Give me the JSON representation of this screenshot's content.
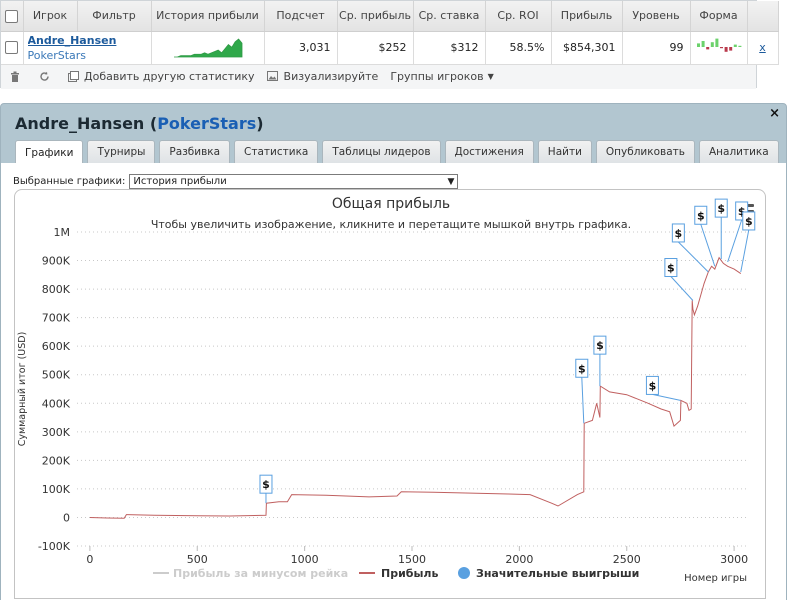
{
  "stats_table": {
    "headers": [
      "Игрок",
      "Фильтр",
      "История прибыли",
      "Подсчет",
      "Ср. прибыль",
      "Ср. ставка",
      "Ср. ROI",
      "Прибыль",
      "Уровень",
      "Форма"
    ],
    "row": {
      "player_name": "Andre_Hansen",
      "player_site": "PokerStars",
      "count": "3,031",
      "avg_profit": "$252",
      "avg_stake": "$312",
      "avg_roi": "58.5%",
      "profit": "$854,301",
      "level": "99",
      "remove_label": "x"
    },
    "history_sparkline": [
      0,
      0,
      1,
      1,
      1,
      1,
      2,
      2,
      2,
      3,
      2,
      3,
      4,
      5,
      3,
      6,
      9,
      7,
      11,
      13,
      10
    ],
    "form_bars": [
      3,
      5,
      -2,
      4,
      7,
      -1,
      -4,
      -3,
      2,
      1
    ]
  },
  "toolbar": {
    "add_stat": "Добавить другую статистику",
    "visualize": "Визуализируйте",
    "groups": "Группы игроков"
  },
  "panel": {
    "player_name": "Andre_Hansen",
    "site": "PokerStars",
    "close": "×",
    "tabs": [
      "Графики",
      "Турниры",
      "Разбивка",
      "Статистика",
      "Таблицы лидеров",
      "Достижения",
      "Найти",
      "Опубликовать",
      "Аналитика"
    ],
    "active_tab": 0
  },
  "graph_select": {
    "label": "Выбранные графики:",
    "value": "История прибыли"
  },
  "colors": {
    "profit_line": "#c06060",
    "no_rake_line": "#cccccc",
    "big_wins": "#5aa0e0",
    "brand_blue": "#1a5fb4"
  },
  "chart_data": {
    "type": "line",
    "title": "Общая прибыль",
    "subtitle": "Чтобы увеличить изображение, кликните и перетащите мышкой внутрь графика.",
    "ylabel": "Суммарный итог (USD)",
    "xlabel": "Номер игры",
    "xlim": [
      -60,
      3060
    ],
    "ylim": [
      -100000,
      1000000
    ],
    "x_ticks": [
      0,
      500,
      1000,
      1500,
      2000,
      2500,
      3000
    ],
    "y_ticks": [
      {
        "v": -100000,
        "label": "-100K"
      },
      {
        "v": 0,
        "label": "0"
      },
      {
        "v": 100000,
        "label": "100K"
      },
      {
        "v": 200000,
        "label": "200K"
      },
      {
        "v": 300000,
        "label": "300K"
      },
      {
        "v": 400000,
        "label": "400K"
      },
      {
        "v": 500000,
        "label": "500K"
      },
      {
        "v": 600000,
        "label": "600K"
      },
      {
        "v": 700000,
        "label": "700K"
      },
      {
        "v": 800000,
        "label": "800K"
      },
      {
        "v": 900000,
        "label": "900K"
      },
      {
        "v": 1000000,
        "label": "1M"
      }
    ],
    "grid": true,
    "legend_position": "bottom",
    "series": [
      {
        "name": "Прибыль за минусом рейка",
        "values": []
      },
      {
        "name": "Прибыль",
        "x": [
          0,
          80,
          160,
          170,
          300,
          500,
          650,
          820,
          822,
          880,
          920,
          940,
          1100,
          1300,
          1430,
          1450,
          1600,
          1800,
          1950,
          2050,
          2150,
          2180,
          2270,
          2300,
          2302,
          2340,
          2360,
          2375,
          2377,
          2420,
          2500,
          2600,
          2660,
          2700,
          2720,
          2750,
          2752,
          2780,
          2790,
          2800,
          2805,
          2808,
          2815,
          2830,
          2860,
          2880,
          2895,
          2910,
          2930,
          2950,
          2970,
          3000,
          3031
        ],
        "values": [
          0,
          -2000,
          -3000,
          10000,
          8000,
          6000,
          5000,
          8000,
          50000,
          55000,
          55000,
          80000,
          78000,
          72000,
          75000,
          90000,
          88000,
          85000,
          82000,
          80000,
          50000,
          40000,
          80000,
          90000,
          330000,
          340000,
          400000,
          350000,
          460000,
          440000,
          430000,
          400000,
          380000,
          370000,
          320000,
          340000,
          410000,
          400000,
          375000,
          380000,
          760000,
          730000,
          710000,
          740000,
          820000,
          860000,
          880000,
          870000,
          910000,
          890000,
          880000,
          870000,
          854301
        ]
      },
      {
        "name": "Значительные выигрыши",
        "x": [
          820,
          2300,
          2375,
          2750,
          2808,
          2880,
          2910,
          2940,
          2970,
          3031
        ],
        "values": [
          50000,
          330000,
          460000,
          410000,
          760000,
          860000,
          880000,
          905000,
          895000,
          860000
        ]
      }
    ]
  }
}
